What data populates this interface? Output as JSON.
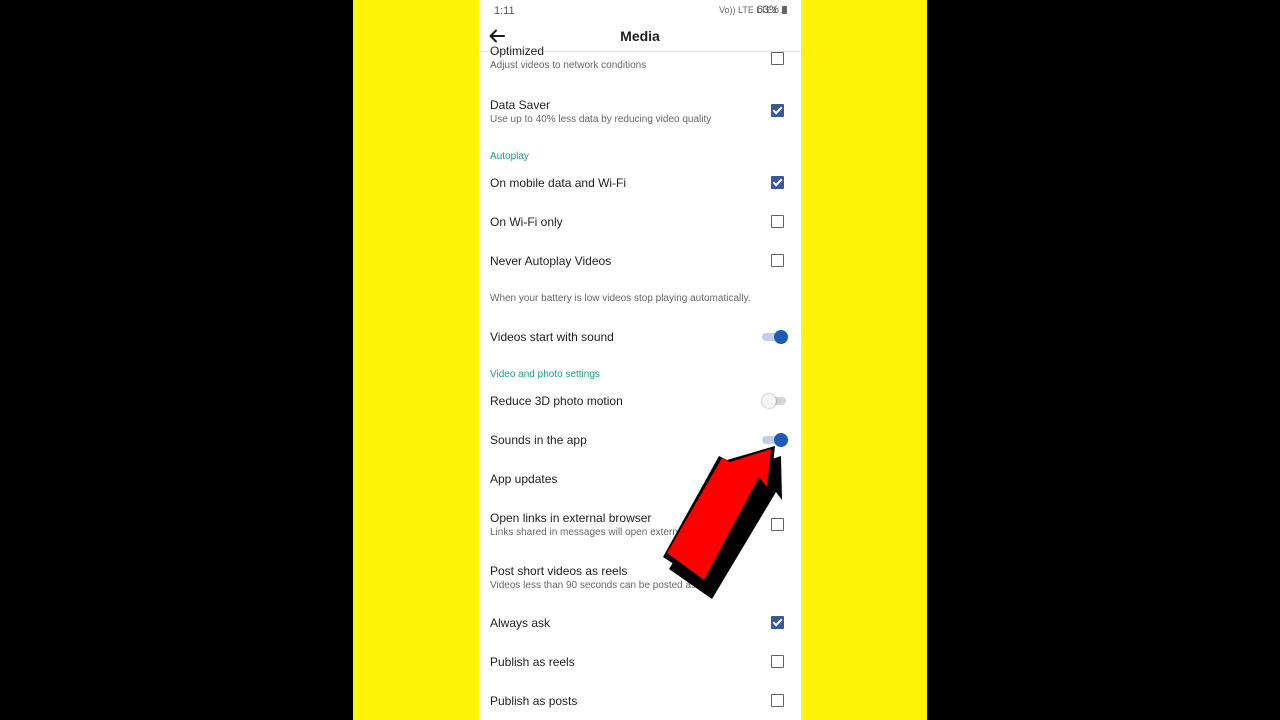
{
  "status": {
    "time": "1:11",
    "icons": "Vo)) LTE LTE1 .il",
    "battery": "63%"
  },
  "appbar": {
    "title": "Media"
  },
  "items": {
    "optimized": {
      "label": "Optimized",
      "sub": "Adjust videos to network conditions",
      "checked": false
    },
    "data_saver": {
      "label": "Data Saver",
      "sub": "Use up to 40% less data by reducing video quality",
      "checked": true
    },
    "autoplay_header": "Autoplay",
    "mobile_wifi": {
      "label": "On mobile data and Wi-Fi",
      "checked": true
    },
    "wifi_only": {
      "label": "On Wi-Fi only",
      "checked": false
    },
    "never_autoplay": {
      "label": "Never Autoplay Videos",
      "checked": false
    },
    "battery_note": "When your battery is low videos stop playing automatically.",
    "start_sound": {
      "label": "Videos start with sound",
      "on": true
    },
    "vp_header": "Video and photo settings",
    "reduce_3d": {
      "label": "Reduce 3D photo motion",
      "on": false
    },
    "sounds_app": {
      "label": "Sounds in the app",
      "on": true
    },
    "app_updates": {
      "label": "App updates"
    },
    "ext_browser": {
      "label": "Open links in external browser",
      "sub": "Links shared in messages will open extern",
      "checked": false
    },
    "short_reels": {
      "label": "Post short videos as reels",
      "sub": "Videos less than 90 seconds can be posted as r..."
    },
    "always_ask": {
      "label": "Always ask",
      "checked": true
    },
    "publish_reels": {
      "label": "Publish as reels",
      "checked": false
    },
    "publish_posts": {
      "label": "Publish as posts",
      "checked": false
    }
  },
  "colors": {
    "background_band": "#fdf306",
    "accent": "#3b5998",
    "section": "#1b9a8a",
    "arrow": "#ff0000"
  }
}
